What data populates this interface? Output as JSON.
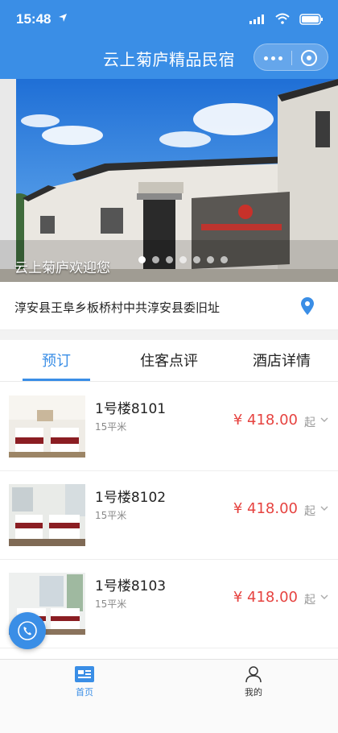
{
  "status_bar": {
    "time": "15:48"
  },
  "nav": {
    "title": "云上菊庐精品民宿"
  },
  "banner": {
    "caption": "云上菊庐欢迎您",
    "slide_count": 7,
    "active_index": 0
  },
  "address": {
    "text": "淳安县王阜乡板桥村中共淳安县委旧址"
  },
  "tabs": [
    {
      "label": "预订",
      "active": true
    },
    {
      "label": "住客点评",
      "active": false
    },
    {
      "label": "酒店详情",
      "active": false
    }
  ],
  "rooms": [
    {
      "name": "1号楼8101",
      "area": "15平米",
      "price": "¥ 418.00",
      "suffix": "起"
    },
    {
      "name": "1号楼8102",
      "area": "15平米",
      "price": "¥ 418.00",
      "suffix": "起"
    },
    {
      "name": "1号楼8103",
      "area": "15平米",
      "price": "¥ 418.00",
      "suffix": "起"
    }
  ],
  "tabbar": {
    "home_label": "首页",
    "mine_label": "我的"
  },
  "colors": {
    "accent": "#3a8ee6",
    "price": "#e64340"
  }
}
